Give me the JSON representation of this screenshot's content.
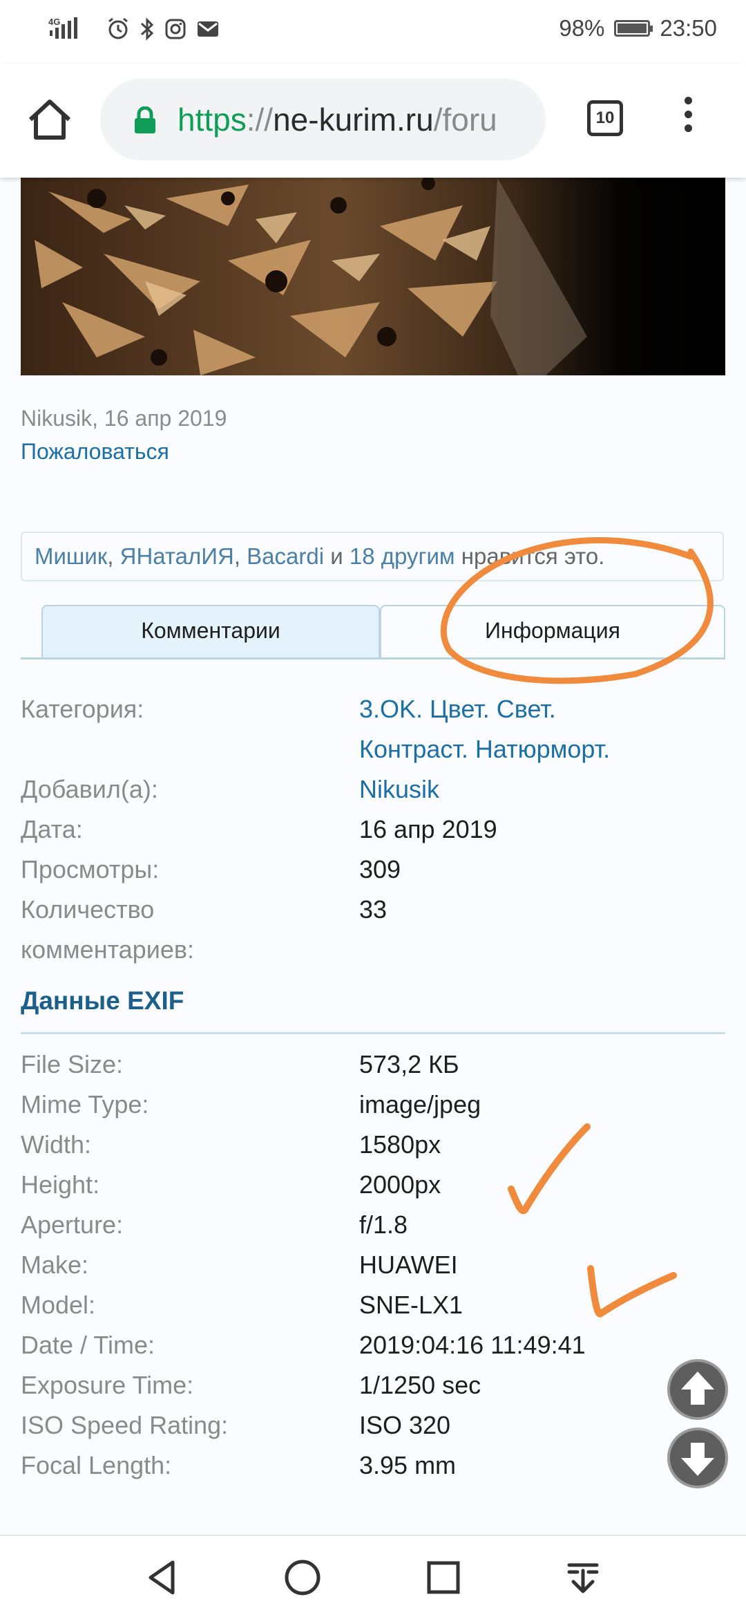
{
  "status_bar": {
    "network": "4G",
    "battery_percent": "98%",
    "time": "23:50"
  },
  "browser": {
    "url_scheme": "https",
    "url_separator": "://",
    "url_host": "ne-kurim.ru",
    "url_path": "/foru",
    "tab_count": "10"
  },
  "post": {
    "meta": "Nikusik, 16 апр 2019",
    "report_link": "Пожаловаться",
    "likes": {
      "user1": "Мишик",
      "sep1": ", ",
      "user2": "ЯНаталИЯ",
      "sep2": ", ",
      "user3": "Bacardi",
      "and": " и ",
      "others": "18 другим",
      "suffix": " нравится это."
    }
  },
  "tabs": {
    "comments": "Комментарии",
    "info": "Информация"
  },
  "info": {
    "category_label": "Категория:",
    "category_value_line1": "3.OK. Цвет. Свет.",
    "category_value_line2": "Контраст. Натюрморт.",
    "added_by_label": "Добавил(а):",
    "added_by_value": "Nikusik",
    "date_label": "Дата:",
    "date_value": "16 апр 2019",
    "views_label": "Просмотры:",
    "views_value": "309",
    "comments_count_label_line1": "Количество",
    "comments_count_label_line2": "комментариев:",
    "comments_count_value": "33"
  },
  "exif": {
    "heading": "Данные EXIF",
    "rows": [
      {
        "label": "File Size:",
        "value": "573,2 КБ"
      },
      {
        "label": "Mime Type:",
        "value": "image/jpeg"
      },
      {
        "label": "Width:",
        "value": "1580px"
      },
      {
        "label": "Height:",
        "value": "2000px"
      },
      {
        "label": "Aperture:",
        "value": "f/1.8"
      },
      {
        "label": "Make:",
        "value": "HUAWEI"
      },
      {
        "label": "Model:",
        "value": "SNE-LX1"
      },
      {
        "label": "Date / Time:",
        "value": "2019:04:16 11:49:41"
      },
      {
        "label": "Exposure Time:",
        "value": "1/1250 sec"
      },
      {
        "label": "ISO Speed Rating:",
        "value": "ISO 320"
      },
      {
        "label": "Focal Length:",
        "value": "3.95 mm"
      }
    ]
  },
  "colors": {
    "link": "#1c6fa6",
    "url_scheme": "#0f9d58",
    "tab_active_bg": "#e3f2fb",
    "annotation": "#f08a3c",
    "exif_heading": "#1c5e8c"
  },
  "icons": {
    "home": "home-icon",
    "lock": "lock-icon",
    "menu": "more-vert-icon",
    "scroll_up": "arrow-up-icon",
    "scroll_down": "arrow-down-icon",
    "nav_back": "back-triangle-icon",
    "nav_home": "home-circle-icon",
    "nav_recents": "recents-square-icon",
    "nav_notifications": "pull-down-icon"
  }
}
